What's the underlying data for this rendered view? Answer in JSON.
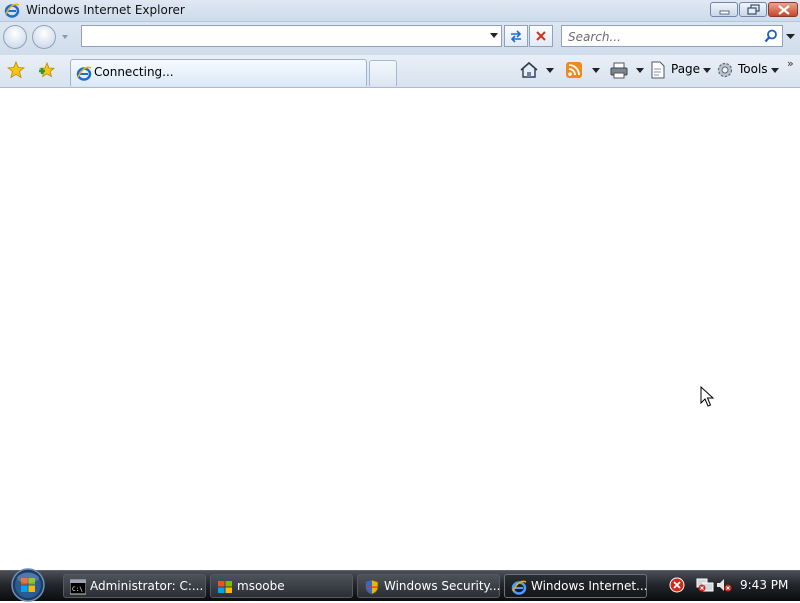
{
  "window": {
    "title": "Windows Internet Explorer",
    "icon": "ie-icon",
    "controls": [
      "minimize-icon",
      "maximize-icon",
      "close-icon"
    ]
  },
  "address_bar": {
    "value": "",
    "placeholder": ""
  },
  "search": {
    "placeholder": "Search..."
  },
  "tabs": [
    {
      "label": "Connecting...",
      "active": true
    }
  ],
  "commands": {
    "page_label": "Page",
    "tools_label": "Tools",
    "overflow": "»"
  },
  "taskbar": {
    "tasks": [
      {
        "label": "Administrator: C:...",
        "icon": "cmd-icon"
      },
      {
        "label": "msoobe",
        "icon": "windows-flag-icon"
      },
      {
        "label": "Windows Security...",
        "icon": "shield-icon"
      },
      {
        "label": "Windows Internet...",
        "icon": "ie-icon",
        "active": true
      }
    ],
    "clock": "9:43 PM"
  },
  "colors": {
    "accent": "#1e6ed1",
    "close_red": "#c9442b",
    "rss_orange": "#f28a1b"
  }
}
